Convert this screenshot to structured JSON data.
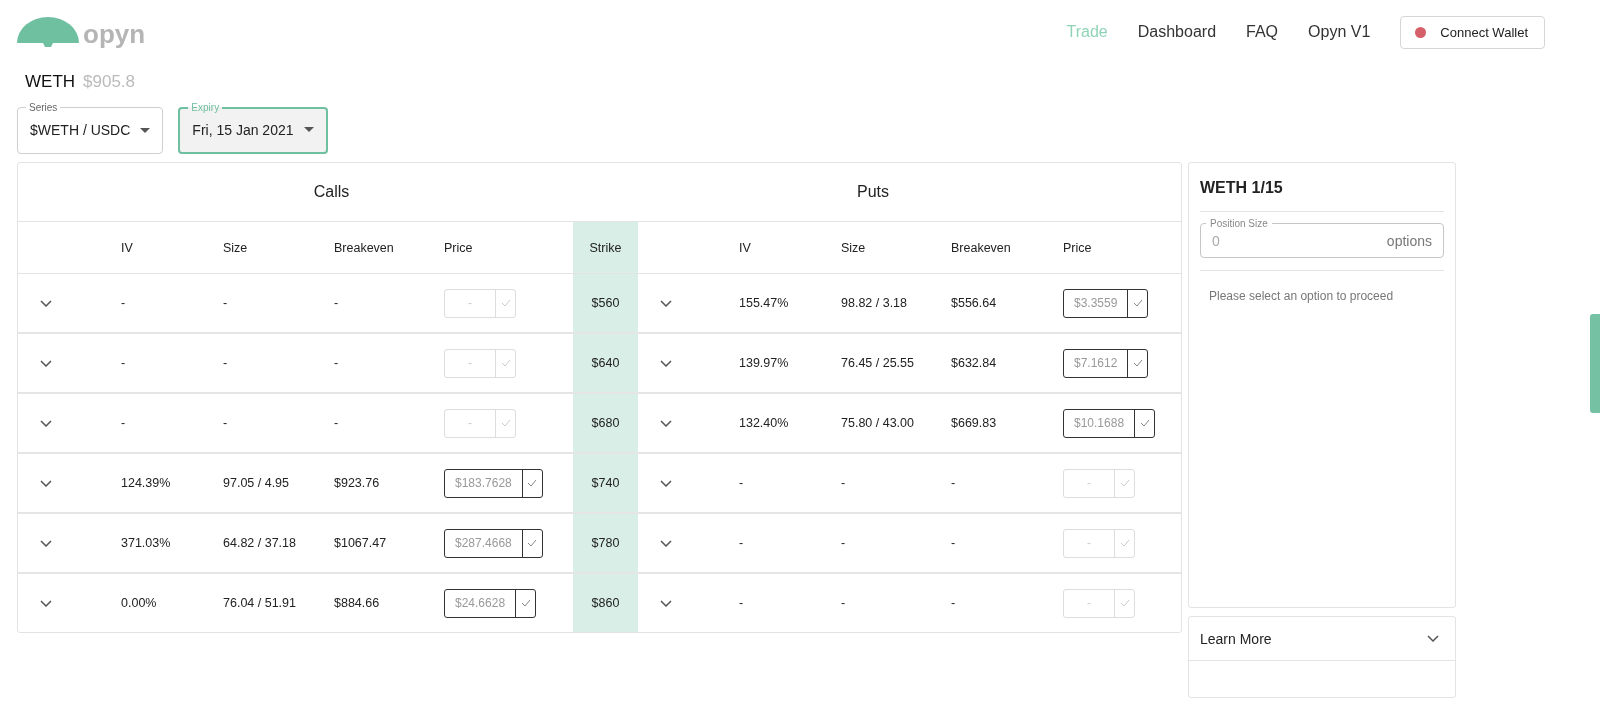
{
  "header": {
    "logo_text": "opyn",
    "nav": [
      {
        "label": "Trade",
        "selected": true
      },
      {
        "label": "Dashboard",
        "selected": false
      },
      {
        "label": "FAQ",
        "selected": false
      },
      {
        "label": "Opyn V1",
        "selected": false
      }
    ],
    "wallet_button": {
      "label": "Connect Wallet",
      "connected": false
    }
  },
  "asset": {
    "symbol": "WETH",
    "price": "$905.8"
  },
  "selects": [
    {
      "label": "Series",
      "value": "$WETH / USDC",
      "focused": false
    },
    {
      "label": "Expiry",
      "value": "Fri, 15 Jan 2021",
      "focused": true
    }
  ],
  "table": {
    "calls_title": "Calls",
    "puts_title": "Puts",
    "columns": [
      "IV",
      "Size",
      "Breakeven",
      "Price",
      "Strike",
      "IV",
      "Size",
      "Breakeven",
      "Price"
    ],
    "rows": [
      {
        "strike": "$560",
        "call": {
          "iv": "-",
          "size": "-",
          "breakeven": "-",
          "price": "-",
          "enabled": false
        },
        "put": {
          "iv": "155.47%",
          "size": "98.82 / 3.18",
          "breakeven": "$556.64",
          "price": "$3.3559",
          "enabled": true
        }
      },
      {
        "strike": "$640",
        "call": {
          "iv": "-",
          "size": "-",
          "breakeven": "-",
          "price": "-",
          "enabled": false
        },
        "put": {
          "iv": "139.97%",
          "size": "76.45 / 25.55",
          "breakeven": "$632.84",
          "price": "$7.1612",
          "enabled": true
        }
      },
      {
        "strike": "$680",
        "call": {
          "iv": "-",
          "size": "-",
          "breakeven": "-",
          "price": "-",
          "enabled": false
        },
        "put": {
          "iv": "132.40%",
          "size": "75.80 / 43.00",
          "breakeven": "$669.83",
          "price": "$10.1688",
          "enabled": true
        }
      },
      {
        "strike": "$740",
        "call": {
          "iv": "124.39%",
          "size": "97.05 / 4.95",
          "breakeven": "$923.76",
          "price": "$183.7628",
          "enabled": true
        },
        "put": {
          "iv": "-",
          "size": "-",
          "breakeven": "-",
          "price": "-",
          "enabled": false
        }
      },
      {
        "strike": "$780",
        "call": {
          "iv": "371.03%",
          "size": "64.82 / 37.18",
          "breakeven": "$1067.47",
          "price": "$287.4668",
          "enabled": true
        },
        "put": {
          "iv": "-",
          "size": "-",
          "breakeven": "-",
          "price": "-",
          "enabled": false
        }
      },
      {
        "strike": "$860",
        "call": {
          "iv": "0.00%",
          "size": "76.04 / 51.91",
          "breakeven": "$884.66",
          "price": "$24.6628",
          "enabled": true
        },
        "put": {
          "iv": "-",
          "size": "-",
          "breakeven": "-",
          "price": "-",
          "enabled": false
        }
      }
    ]
  },
  "order_panel": {
    "title": "WETH 1/15",
    "position_size": {
      "label": "Position Size",
      "placeholder": "0",
      "unit": "options"
    },
    "message": "Please select an option to proceed"
  },
  "learn_more": {
    "label": "Learn More",
    "expanded": false
  }
}
